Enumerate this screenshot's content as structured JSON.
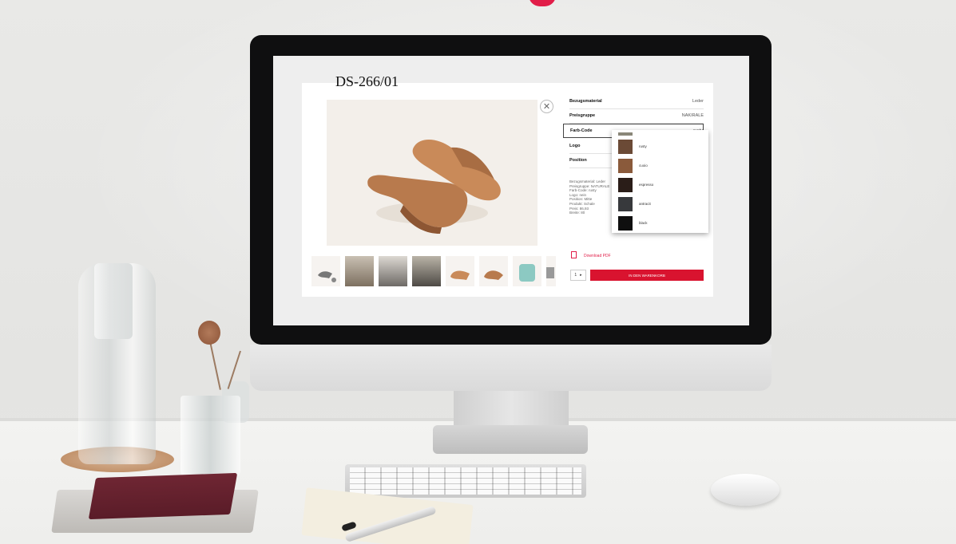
{
  "page": {
    "title": "DS-266/01"
  },
  "config": {
    "rows": [
      {
        "label": "Bezugsmaterial",
        "value": "Leder"
      },
      {
        "label": "Preisgruppe",
        "value": "NAKIRALE"
      },
      {
        "label": "Farb-Code",
        "value": "rusty"
      },
      {
        "label": "Logo",
        "value": ""
      },
      {
        "label": "Position",
        "value": ""
      }
    ],
    "summary": [
      "Bezugsmaterial: Leder",
      "Preisgruppe: NATURALE",
      "Farb-Code: rusty",
      "Logo: nein",
      "Position: Mitte",
      "Produkt: Schale",
      "Preis: 86,93",
      "Breite: 80"
    ]
  },
  "colors": {
    "options": [
      {
        "name": "rusty",
        "color": "#6b4a36"
      },
      {
        "name": "cuoio",
        "color": "#8a5a3b"
      },
      {
        "name": "espresso",
        "color": "#2a1d18"
      },
      {
        "name": "antracit",
        "color": "#37393c"
      },
      {
        "name": "black",
        "color": "#0f0f0f"
      }
    ]
  },
  "actions": {
    "download_pdf": "Download PDF",
    "quantity": "1",
    "add_to_cart": "IN DEN WARENKORB"
  },
  "thumbnails": [
    "chair-side",
    "living-room",
    "room-view",
    "interior",
    "chair-front",
    "chair-angle",
    "chair-teal",
    "chair-grey"
  ]
}
